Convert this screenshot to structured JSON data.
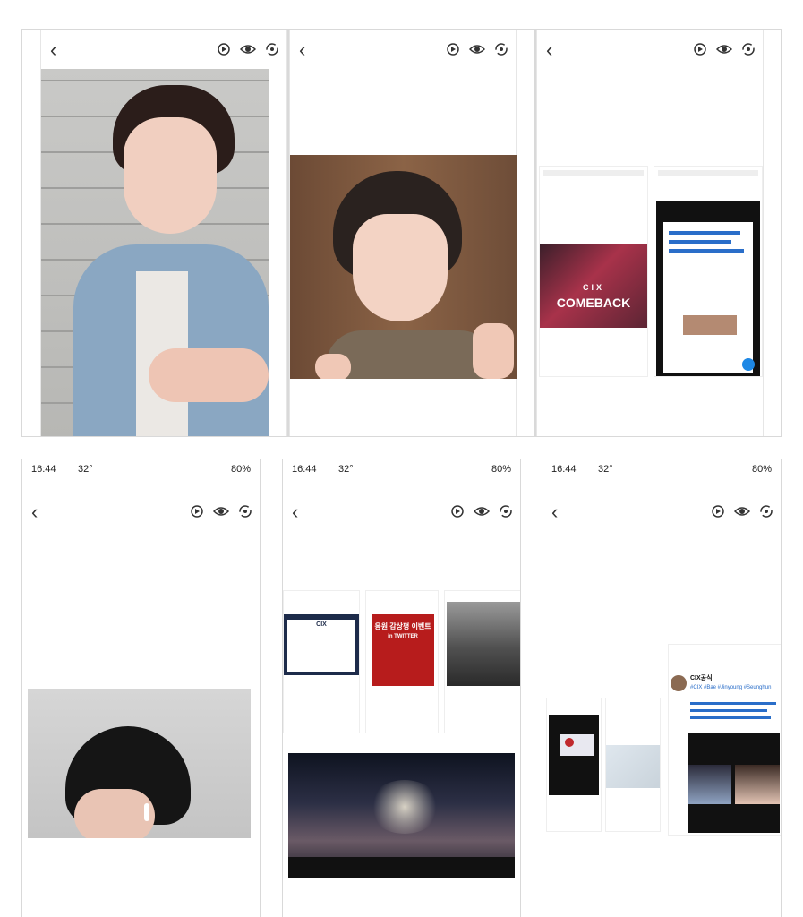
{
  "status_bar": {
    "time": "16:44",
    "temp": "32°",
    "battery": "80%"
  },
  "shot_bottom_left": {
    "overlay_text": "COMEBACK",
    "overlay_sub": "CIX"
  },
  "shot_bottom_middle": {
    "banner_title": "응원 감상평 이벤트",
    "banner_sub": "in TWITTER",
    "doc_title": "CIX"
  },
  "tweet": {
    "handle": "CIX공식",
    "snippet": "#CIX #Bae #Jinyoung #Seunghun"
  },
  "colors": {
    "accent_red": "#b71c1c",
    "link_blue": "#2a6ec9",
    "fab_blue": "#1e88e5"
  }
}
